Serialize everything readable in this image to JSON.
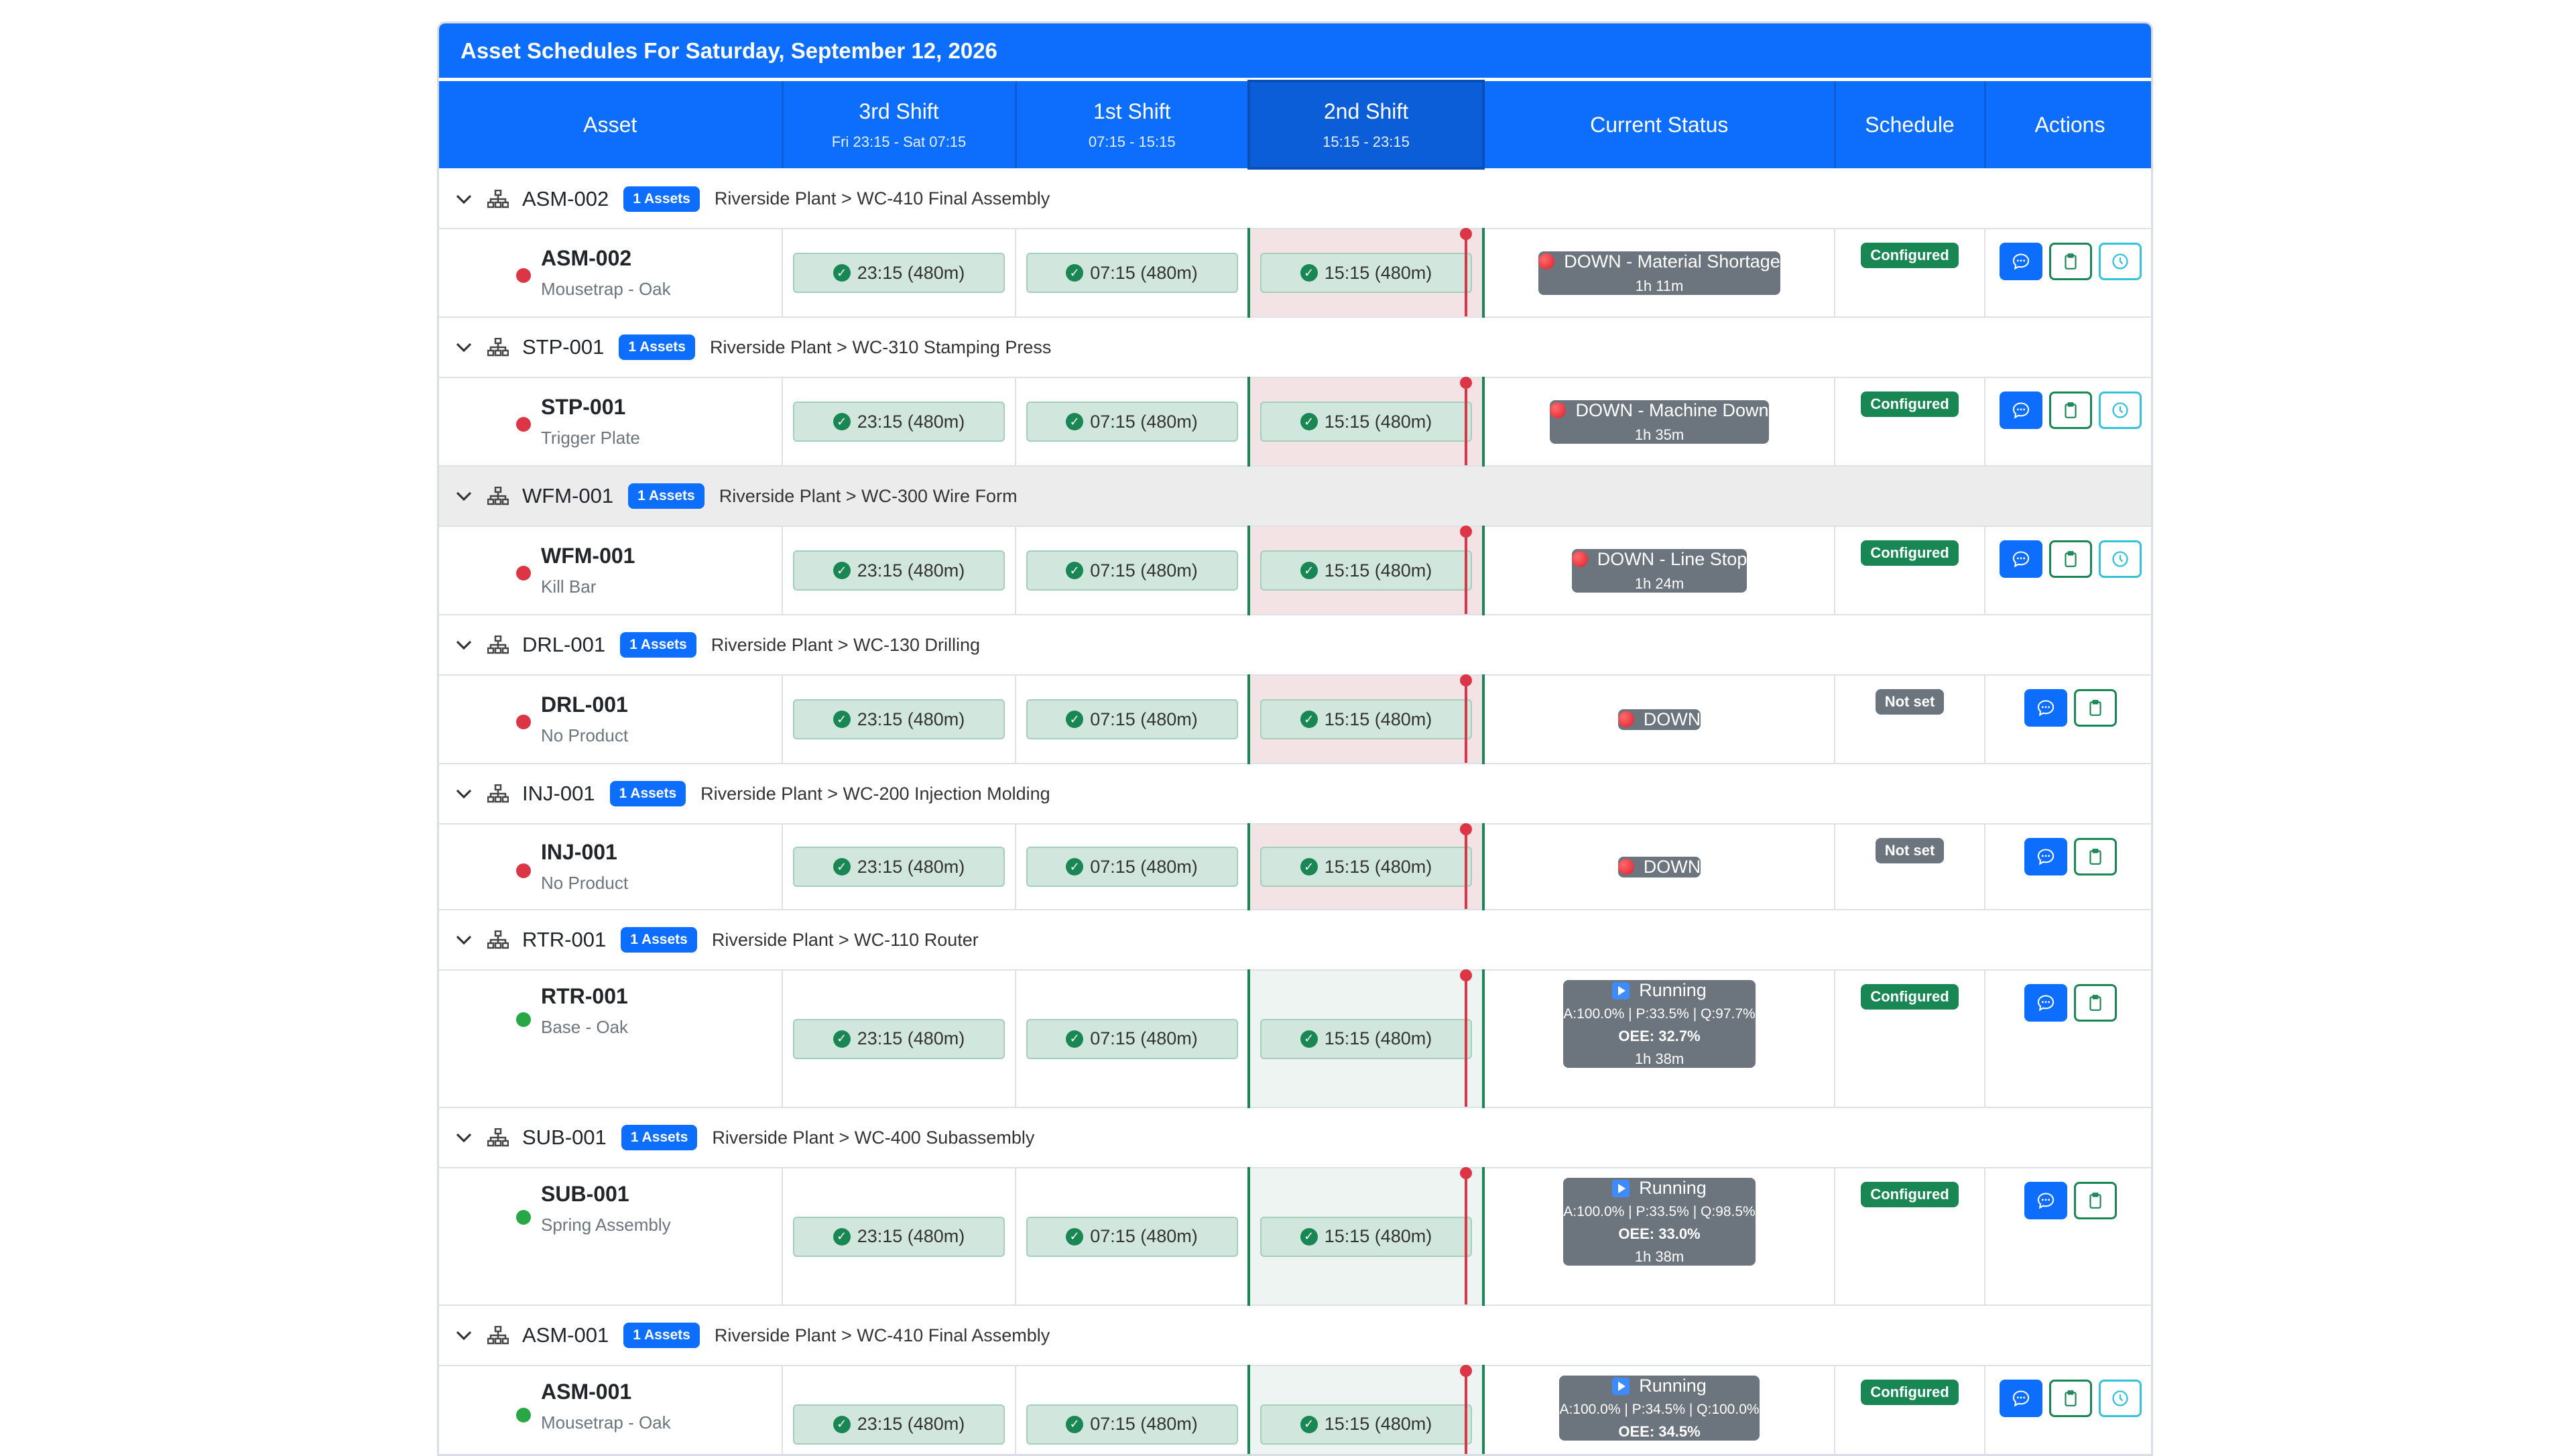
{
  "title": "Asset Schedules For Saturday, September 12, 2026",
  "headers": {
    "asset": "Asset",
    "shift3": {
      "label": "3rd Shift",
      "time": "Fri 23:15 - Sat 07:15"
    },
    "shift1": {
      "label": "1st Shift",
      "time": "07:15 - 15:15"
    },
    "shift2": {
      "label": "2nd Shift",
      "time": "15:15 - 23:15"
    },
    "status": "Current Status",
    "schedule": "Schedule",
    "actions": "Actions"
  },
  "groups": [
    {
      "name": "ASM-002",
      "count": "1 Assets",
      "path": "Riverside Plant > WC-410 Final Assembly",
      "asset": {
        "name": "ASM-002",
        "product": "Mousetrap - Oak",
        "state": "down",
        "shift3": "23:15 (480m)",
        "shift1": "07:15 (480m)",
        "shift2": "15:15 (480m)",
        "status_main": "DOWN - Material Shortage",
        "status_dur": "1h 11m",
        "schedule": "Configured"
      }
    },
    {
      "name": "STP-001",
      "count": "1 Assets",
      "path": "Riverside Plant > WC-310 Stamping Press",
      "asset": {
        "name": "STP-001",
        "product": "Trigger Plate",
        "state": "down",
        "shift3": "23:15 (480m)",
        "shift1": "07:15 (480m)",
        "shift2": "15:15 (480m)",
        "status_main": "DOWN - Machine Down",
        "status_dur": "1h 35m",
        "schedule": "Configured"
      }
    },
    {
      "name": "WFM-001",
      "count": "1 Assets",
      "path": "Riverside Plant > WC-300 Wire Form",
      "asset": {
        "name": "WFM-001",
        "product": "Kill Bar",
        "state": "down",
        "shift3": "23:15 (480m)",
        "shift1": "07:15 (480m)",
        "shift2": "15:15 (480m)",
        "status_main": "DOWN - Line Stop",
        "status_dur": "1h 24m",
        "schedule": "Configured"
      }
    },
    {
      "name": "DRL-001",
      "count": "1 Assets",
      "path": "Riverside Plant > WC-130 Drilling",
      "asset": {
        "name": "DRL-001",
        "product": "No Product",
        "state": "down",
        "shift3": "23:15 (480m)",
        "shift1": "07:15 (480m)",
        "shift2": "15:15 (480m)",
        "status_main": "DOWN",
        "schedule": "Not set"
      }
    },
    {
      "name": "INJ-001",
      "count": "1 Assets",
      "path": "Riverside Plant > WC-200 Injection Molding",
      "asset": {
        "name": "INJ-001",
        "product": "No Product",
        "state": "down",
        "shift3": "23:15 (480m)",
        "shift1": "07:15 (480m)",
        "shift2": "15:15 (480m)",
        "status_main": "DOWN",
        "schedule": "Not set"
      }
    },
    {
      "name": "RTR-001",
      "count": "1 Assets",
      "path": "Riverside Plant > WC-110 Router",
      "asset": {
        "name": "RTR-001",
        "product": "Base - Oak",
        "state": "running",
        "shift3": "23:15 (480m)",
        "shift1": "07:15 (480m)",
        "shift2": "15:15 (480m)",
        "status_main": "Running",
        "metrics": "A:100.0% | P:33.5% | Q:97.7%",
        "oee": "OEE: 32.7%",
        "status_dur": "1h 38m",
        "schedule": "Configured"
      }
    },
    {
      "name": "SUB-001",
      "count": "1 Assets",
      "path": "Riverside Plant > WC-400 Subassembly",
      "asset": {
        "name": "SUB-001",
        "product": "Spring Assembly",
        "state": "running",
        "shift3": "23:15 (480m)",
        "shift1": "07:15 (480m)",
        "shift2": "15:15 (480m)",
        "status_main": "Running",
        "metrics": "A:100.0% | P:33.5% | Q:98.5%",
        "oee": "OEE: 33.0%",
        "status_dur": "1h 38m",
        "schedule": "Configured"
      }
    },
    {
      "name": "ASM-001",
      "count": "1 Assets",
      "path": "Riverside Plant > WC-410 Final Assembly",
      "asset": {
        "name": "ASM-001",
        "product": "Mousetrap - Oak",
        "state": "running",
        "shift3": "23:15 (480m)",
        "shift1": "07:15 (480m)",
        "shift2": "15:15 (480m)",
        "status_main": "Running",
        "metrics": "A:100.0% | P:34.5% | Q:100.0%",
        "oee": "OEE: 34.5%",
        "schedule": "Configured"
      }
    }
  ],
  "colors": {
    "primary": "#0d6efd",
    "success": "#198754",
    "danger": "#dc3545",
    "secondary": "#6c757d"
  }
}
